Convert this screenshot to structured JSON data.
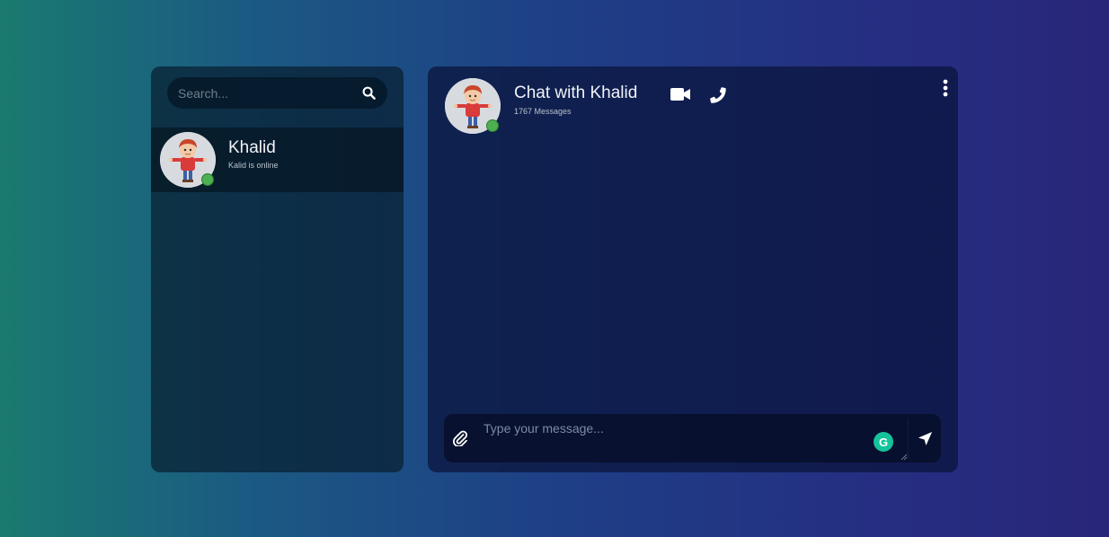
{
  "search": {
    "placeholder": "Search..."
  },
  "contacts": [
    {
      "name": "Khalid",
      "status": "Kalid is online",
      "online": true
    }
  ],
  "chat": {
    "title": "Chat with Khalid",
    "message_count": "1767 Messages"
  },
  "composer": {
    "placeholder": "Type your message..."
  },
  "grammarly": {
    "glyph": "G"
  },
  "icons": {
    "search": "search-icon",
    "video": "video-camera-icon",
    "phone": "phone-icon",
    "more": "more-vertical-icon",
    "attach": "paperclip-icon",
    "send": "send-arrow-icon"
  },
  "colors": {
    "online": "#4caf50",
    "grammarly": "#15c39a"
  }
}
